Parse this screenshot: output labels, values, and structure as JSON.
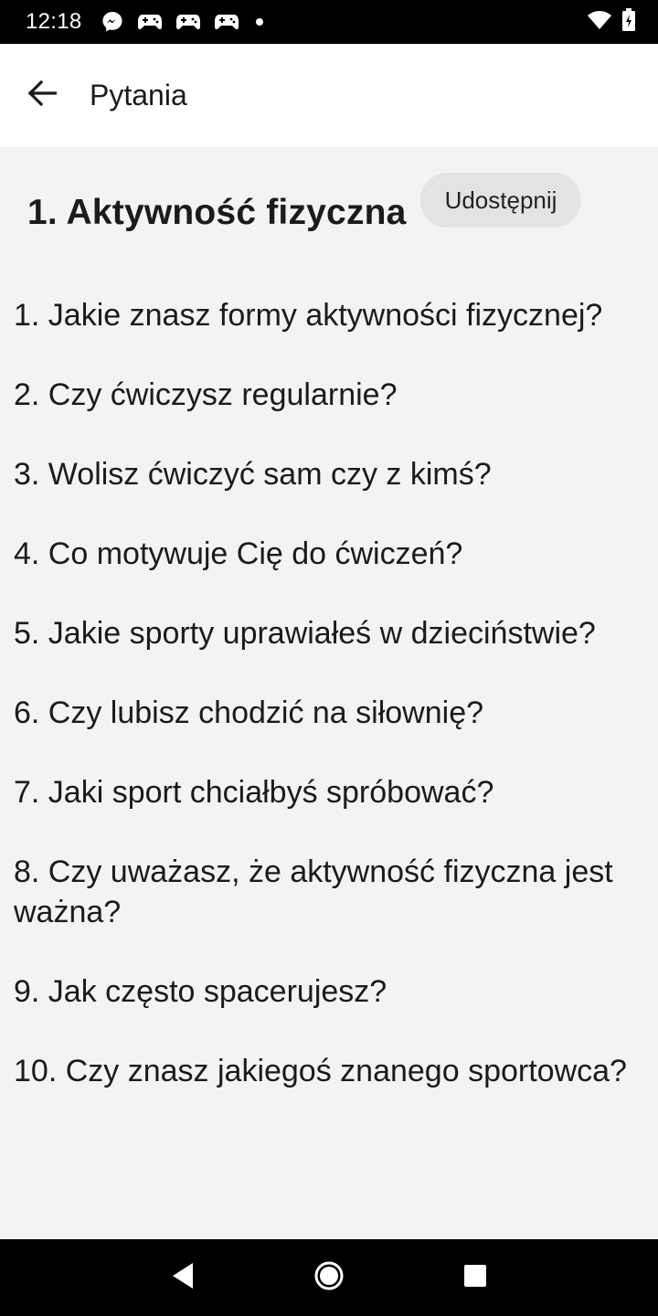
{
  "status_bar": {
    "time": "12:18",
    "icons": [
      "messenger-icon",
      "game-controller-icon",
      "game-controller-icon",
      "game-controller-icon",
      "notification-dot-icon",
      "wifi-icon",
      "battery-icon"
    ]
  },
  "app_bar": {
    "title": "Pytania",
    "back_icon": "arrow-left-icon"
  },
  "section": {
    "title": "1. Aktywność fizyczna",
    "share_label": "Udostępnij"
  },
  "questions": [
    "1. Jakie znasz formy aktywności fizycznej?",
    "2. Czy ćwiczysz regularnie?",
    "3. Wolisz ćwiczyć sam czy z kimś?",
    "4. Co motywuje Cię do ćwiczeń?",
    "5. Jakie sporty uprawiałeś w dzieciństwie?",
    "6. Czy lubisz chodzić na siłownię?",
    "7. Jaki sport chciałbyś spróbować?",
    "8. Czy uważasz, że aktywność fizyczna jest ważna?",
    "9. Jak często spacerujesz?",
    "10. Czy znasz jakiegoś znanego sportowca?"
  ],
  "nav_bar": {
    "icons": [
      "back-triangle-icon",
      "home-circle-icon",
      "recents-square-icon"
    ]
  },
  "colors": {
    "status_bar": "#000000",
    "app_bar": "#ffffff",
    "background": "#f3f3f3",
    "share_button": "#e3e3e3",
    "text": "#1b1b1b"
  }
}
